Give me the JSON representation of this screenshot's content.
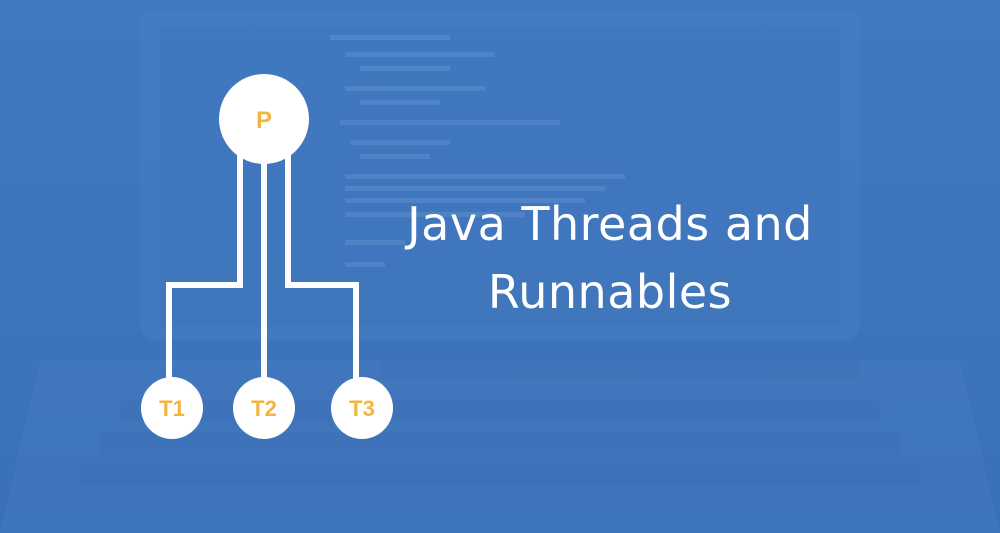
{
  "banner": {
    "title_line1": "Java Threads and",
    "title_line2": "Runnables"
  },
  "diagram": {
    "parent": "P",
    "children": [
      "T1",
      "T2",
      "T3"
    ]
  },
  "colors": {
    "background": "#3f76be",
    "node_fill": "#ffffff",
    "node_text": "#f2b53f",
    "connector": "#ffffff"
  }
}
